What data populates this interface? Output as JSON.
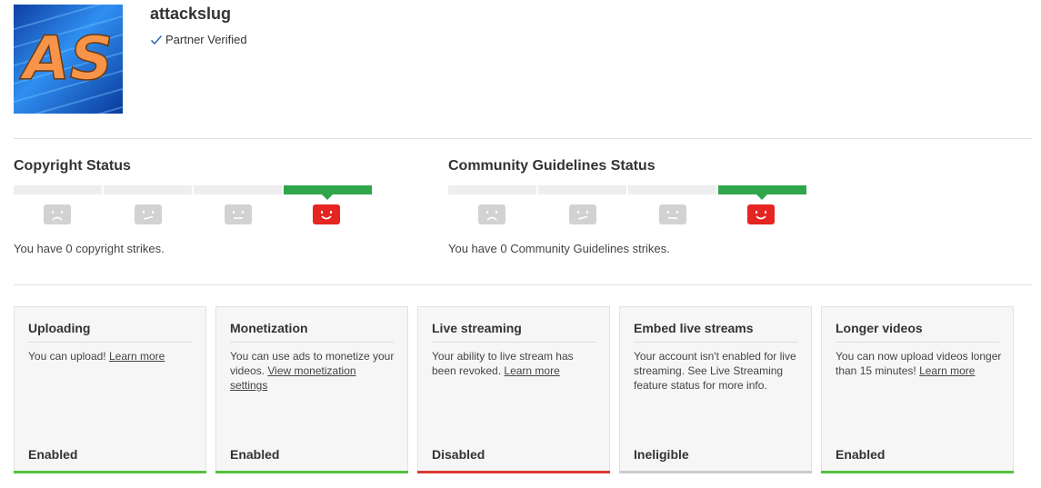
{
  "channel": {
    "name": "attackslug",
    "badge": "Partner Verified",
    "avatar_text": "AS"
  },
  "copyright": {
    "title": "Copyright Status",
    "strike_text": "You have 0 copyright strikes.",
    "active_level": 4
  },
  "community": {
    "title": "Community Guidelines Status",
    "strike_text": "You have 0 Community Guidelines strikes.",
    "active_level": 4
  },
  "cards": [
    {
      "title": "Uploading",
      "text": "You can upload!",
      "link": "Learn more",
      "status": "Enabled",
      "status_color": "#55c13e"
    },
    {
      "title": "Monetization",
      "text": "You can use ads to monetize your videos.",
      "link": "View monetization settings",
      "status": "Enabled",
      "status_color": "#55c13e"
    },
    {
      "title": "Live streaming",
      "text": "Your ability to live stream has been revoked.",
      "link": "Learn more",
      "status": "Disabled",
      "status_color": "#d93a32"
    },
    {
      "title": "Embed live streams",
      "text": "Your account isn't enabled for live streaming. See Live Streaming feature status for more info.",
      "link": "",
      "status": "Ineligible",
      "status_color": "#cccccc"
    },
    {
      "title": "Longer videos",
      "text": "You can now upload videos longer than 15 minutes!",
      "link": "Learn more",
      "status": "Enabled",
      "status_color": "#55c13e"
    }
  ],
  "colors": {
    "good": "#2fa64a",
    "face_active": "#e52521",
    "face_inactive": "#d2d2d2",
    "enabled": "#55c13e",
    "disabled": "#d93a32",
    "ineligible": "#cccccc"
  }
}
